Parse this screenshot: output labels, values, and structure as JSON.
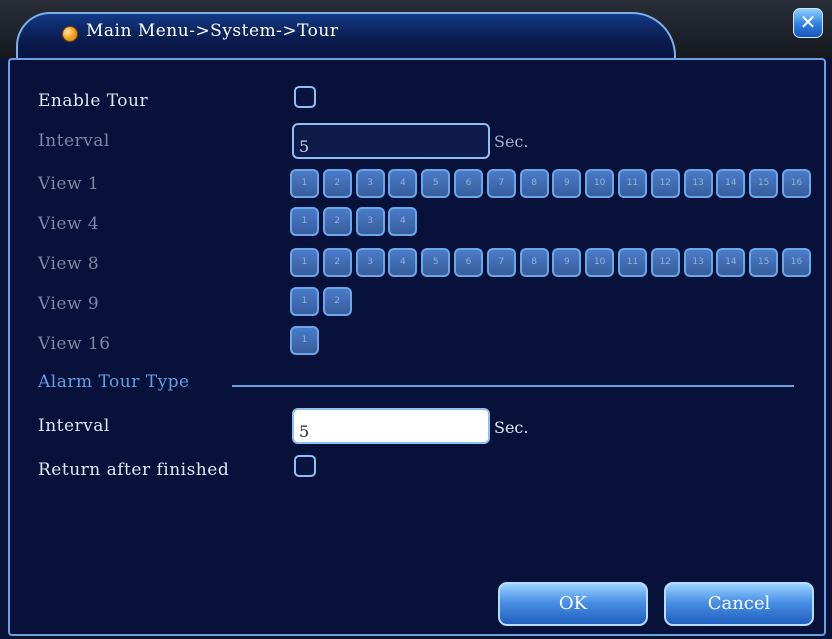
{
  "window": {
    "title": "Main Menu->System->Tour",
    "close_icon": "close-icon"
  },
  "enable_tour": {
    "label": "Enable Tour",
    "checked": false
  },
  "interval": {
    "label": "Interval",
    "value": "5",
    "unit": "Sec."
  },
  "views": [
    {
      "label": "View 1",
      "channels": [
        "1",
        "2",
        "3",
        "4",
        "5",
        "6",
        "7",
        "8",
        "9",
        "10",
        "11",
        "12",
        "13",
        "14",
        "15",
        "16"
      ]
    },
    {
      "label": "View 4",
      "channels": [
        "1",
        "2",
        "3",
        "4"
      ]
    },
    {
      "label": "View 8",
      "channels": [
        "1",
        "2",
        "3",
        "4",
        "5",
        "6",
        "7",
        "8",
        "9",
        "10",
        "11",
        "12",
        "13",
        "14",
        "15",
        "16"
      ]
    },
    {
      "label": "View 9",
      "channels": [
        "1",
        "2"
      ]
    },
    {
      "label": "View 16",
      "channels": [
        "1"
      ]
    }
  ],
  "alarm_tour": {
    "section_label": "Alarm Tour Type",
    "interval_label": "Interval",
    "interval_value": "5",
    "interval_unit": "Sec.",
    "return_label": "Return after finished",
    "return_checked": false
  },
  "buttons": {
    "ok": "OK",
    "cancel": "Cancel"
  },
  "colors": {
    "panel_bg": "#08113a",
    "border": "#6aa0e0",
    "section": "#5fa0e8"
  }
}
